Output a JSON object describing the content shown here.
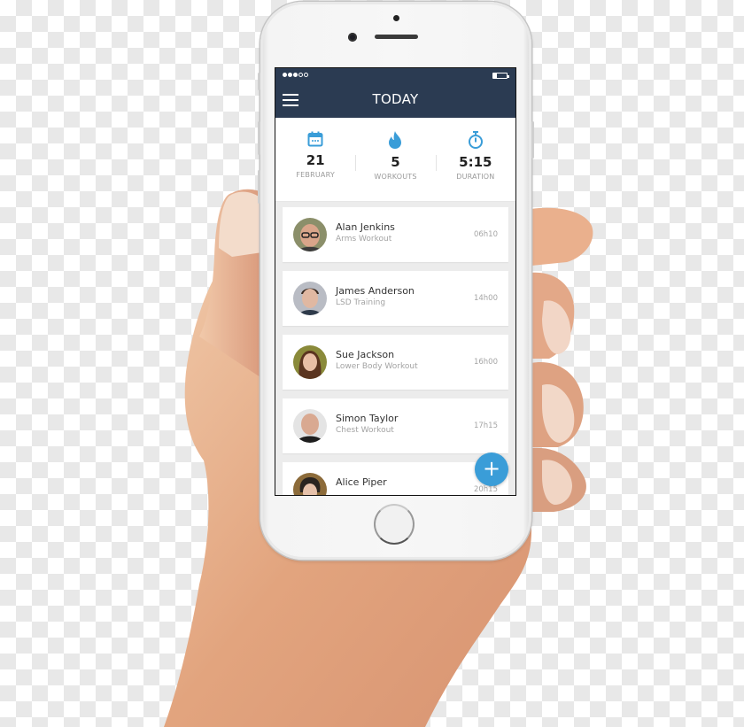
{
  "colors": {
    "appbar": "#2b3b52",
    "accent": "#3a9dd8",
    "card": "#ffffff",
    "list_bg": "#ececec"
  },
  "status_bar": {
    "signal_dots_filled": 3,
    "signal_dots_total": 5,
    "battery_level": 0.25,
    "signal_icon": "signal-dots-icon",
    "battery_icon": "battery-icon"
  },
  "header": {
    "title": "TODAY",
    "menu_icon": "hamburger-menu-icon"
  },
  "stats": [
    {
      "icon": "calendar-icon",
      "value": "21",
      "label": "FEBRUARY"
    },
    {
      "icon": "flame-icon",
      "value": "5",
      "label": "WORKOUTS"
    },
    {
      "icon": "stopwatch-icon",
      "value": "5:15",
      "label": "DURATION"
    }
  ],
  "workouts": [
    {
      "name": "Alan Jenkins",
      "workout": "Arms Workout",
      "time": "06h10"
    },
    {
      "name": "James Anderson",
      "workout": "LSD Training",
      "time": "14h00"
    },
    {
      "name": "Sue Jackson",
      "workout": "Lower Body Workout",
      "time": "16h00"
    },
    {
      "name": "Simon Taylor",
      "workout": "Chest Workout",
      "time": "17h15"
    },
    {
      "name": "Alice Piper",
      "workout": "",
      "time": "20h15"
    }
  ],
  "fab": {
    "label": "+",
    "icon": "plus-icon"
  }
}
